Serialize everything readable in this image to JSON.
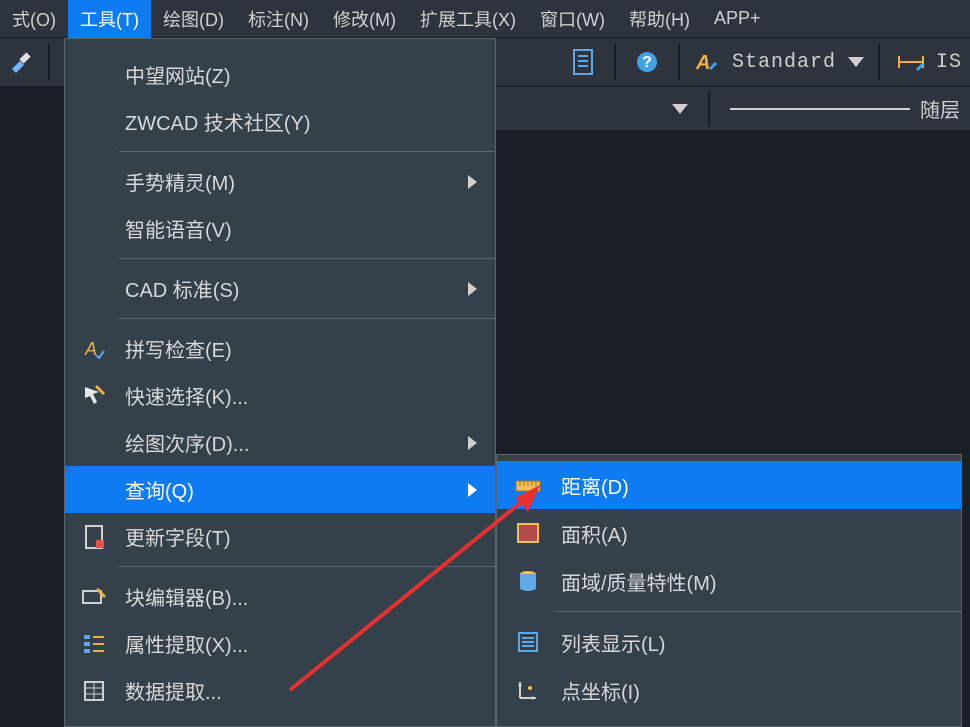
{
  "menubar": {
    "items": [
      {
        "label": "式(O)"
      },
      {
        "label": "工具(T)"
      },
      {
        "label": "绘图(D)"
      },
      {
        "label": "标注(N)"
      },
      {
        "label": "修改(M)"
      },
      {
        "label": "扩展工具(X)"
      },
      {
        "label": "窗口(W)"
      },
      {
        "label": "帮助(H)"
      },
      {
        "label": "APP+"
      }
    ],
    "active_index": 1
  },
  "toolbar_right": {
    "text_style_label": "Standard",
    "dim_label": "IS"
  },
  "toolbar2": {
    "layer_label": "随层"
  },
  "tools_menu": {
    "items": [
      {
        "label": "中望网站(Z)",
        "icon": null,
        "has_submenu": false
      },
      {
        "label": "ZWCAD 技术社区(Y)",
        "icon": null,
        "has_submenu": false
      },
      null,
      {
        "label": "手势精灵(M)",
        "icon": null,
        "has_submenu": true
      },
      {
        "label": "智能语音(V)",
        "icon": null,
        "has_submenu": false
      },
      null,
      {
        "label": "CAD 标准(S)",
        "icon": null,
        "has_submenu": true
      },
      null,
      {
        "label": "拼写检查(E)",
        "icon": "spell-check",
        "has_submenu": false
      },
      {
        "label": "快速选择(K)...",
        "icon": "quick-select",
        "has_submenu": false
      },
      {
        "label": "绘图次序(D)...",
        "icon": null,
        "has_submenu": true
      },
      {
        "label": "查询(Q)",
        "icon": null,
        "has_submenu": true,
        "highlighted": true
      },
      {
        "label": "更新字段(T)",
        "icon": "update-field",
        "has_submenu": false
      },
      null,
      {
        "label": "块编辑器(B)...",
        "icon": "block-editor",
        "has_submenu": false
      },
      {
        "label": "属性提取(X)...",
        "icon": "attr-extract",
        "has_submenu": false
      },
      {
        "label": "数据提取...",
        "icon": "data-extract",
        "has_submenu": false
      }
    ]
  },
  "query_submenu": {
    "items": [
      {
        "label": "距离(D)",
        "icon": "distance",
        "highlighted": true
      },
      {
        "label": "面积(A)",
        "icon": "area"
      },
      {
        "label": "面域/质量特性(M)",
        "icon": "mass-props"
      },
      null,
      {
        "label": "列表显示(L)",
        "icon": "list"
      },
      {
        "label": "点坐标(I)",
        "icon": "point-coord"
      }
    ]
  }
}
